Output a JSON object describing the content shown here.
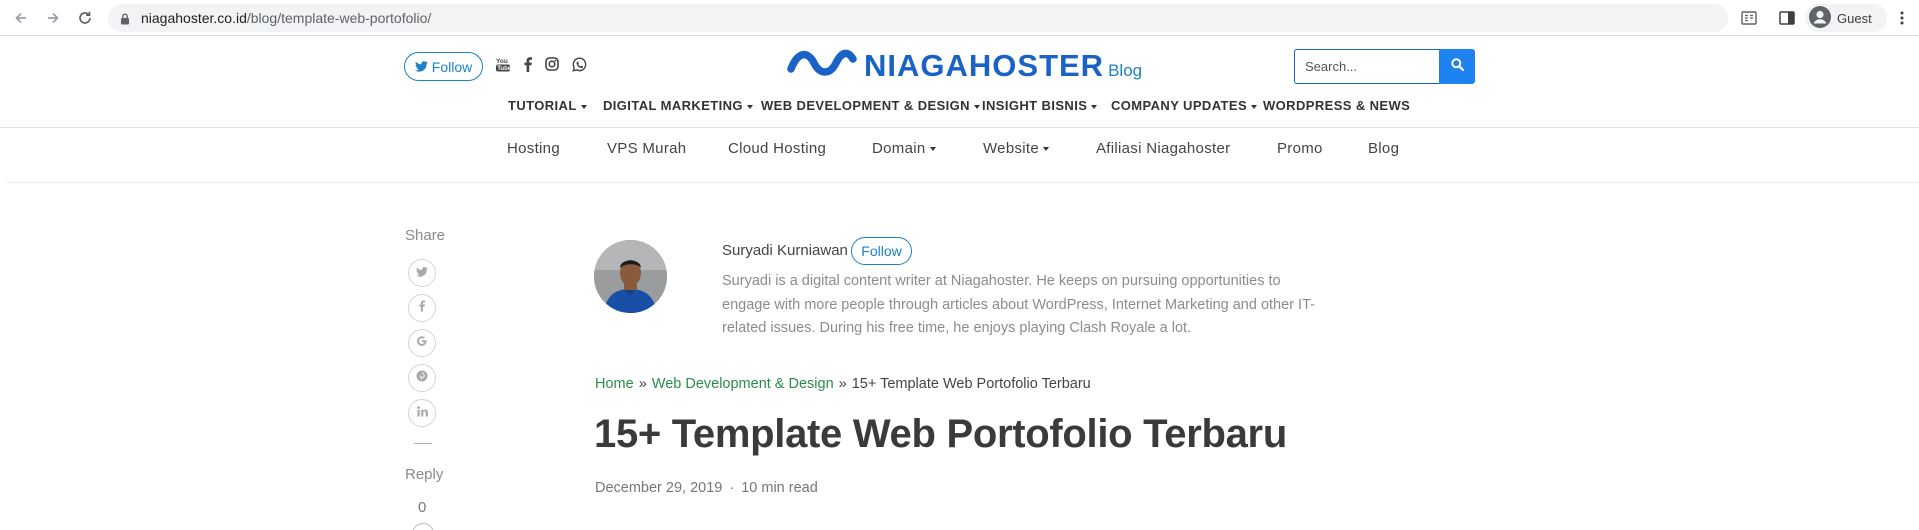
{
  "browser": {
    "url_host": "niagahoster.co.id",
    "url_path": "/blog/template-web-portofolio/",
    "profile_label": "Guest"
  },
  "header": {
    "follow_label": "Follow",
    "logo_text": "NIAGAHOSTER",
    "logo_suffix": "Blog",
    "search_placeholder": "Search...",
    "social_icons": [
      "youtube-icon",
      "facebook-icon",
      "instagram-icon",
      "whatsapp-icon"
    ]
  },
  "category_nav": {
    "items": [
      {
        "label": "TUTORIAL",
        "dropdown": true
      },
      {
        "label": "DIGITAL MARKETING",
        "dropdown": true
      },
      {
        "label": "WEB DEVELOPMENT & DESIGN",
        "dropdown": true
      },
      {
        "label": "INSIGHT BISNIS",
        "dropdown": true
      },
      {
        "label": "COMPANY UPDATES",
        "dropdown": true
      },
      {
        "label": "WORDPRESS & NEWS",
        "dropdown": false
      }
    ]
  },
  "main_nav": {
    "items": [
      {
        "label": "Hosting",
        "dropdown": false
      },
      {
        "label": "VPS Murah",
        "dropdown": false
      },
      {
        "label": "Cloud Hosting",
        "dropdown": false
      },
      {
        "label": "Domain",
        "dropdown": true
      },
      {
        "label": "Website",
        "dropdown": true
      },
      {
        "label": "Afiliasi Niagahoster",
        "dropdown": false
      },
      {
        "label": "Promo",
        "dropdown": false
      },
      {
        "label": "Blog",
        "dropdown": false
      }
    ]
  },
  "share": {
    "label": "Share",
    "buttons": [
      "twitter-icon",
      "facebook-icon",
      "google-icon",
      "pinterest-icon",
      "linkedin-icon"
    ],
    "reply_label": "Reply",
    "reply_count": "0"
  },
  "author": {
    "name": "Suryadi Kurniawan",
    "follow_label": "Follow",
    "bio_lines": [
      "Suryadi is a digital content writer at Niagahoster. He keeps on pursuing opportunities to",
      "engage with more people through articles about WordPress, Internet Marketing and other IT-",
      "related issues. During his free time, he enjoys playing Clash Royale a lot."
    ]
  },
  "article": {
    "breadcrumb": {
      "home": "Home",
      "separator": "»",
      "category": "Web Development & Design",
      "current": "15+ Template Web Portofolio Terbaru"
    },
    "title": "15+ Template Web Portofolio Terbaru",
    "date": "December 29, 2019",
    "meta_separator": "·",
    "read_time": "10 min read"
  },
  "colors": {
    "brand_blue": "#1a62c6",
    "accent_blue": "#1e82c6",
    "search_button": "#1e82f0",
    "link_green": "#2b8a4f"
  }
}
